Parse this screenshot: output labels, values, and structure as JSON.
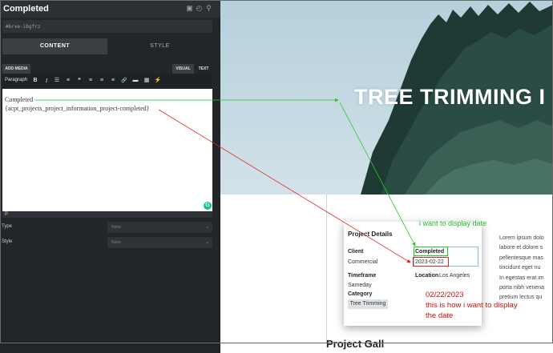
{
  "panel": {
    "title": "Completed",
    "header_icons": [
      "pages-icon",
      "history-icon",
      "search-icon"
    ],
    "element_id": "#brxe-ibgfrz",
    "tabs": [
      {
        "label": "CONTENT",
        "active": true
      },
      {
        "label": "STYLE",
        "active": false
      }
    ],
    "add_media_label": "ADD MEDIA",
    "visual_label": "VISUAL",
    "text_label": "TEXT",
    "format_select": "Paragraph",
    "toolbar_icons": [
      "bold-icon",
      "italic-icon",
      "bullet-list-icon",
      "numbered-list-icon",
      "blockquote-icon",
      "align-left-icon",
      "align-center-icon",
      "align-right-icon",
      "link-icon",
      "horizontal-rule-icon",
      "toolbar-toggle-icon",
      "lightning-icon"
    ],
    "toolbar_glyphs": [
      "B",
      "I",
      "☰",
      "≡",
      "❝",
      "≡",
      "≡",
      "≡",
      "🔗",
      "▬",
      "▦",
      "⚡"
    ],
    "editor_line1": "Completed",
    "editor_line2": "{acpt_projects_project_information_project-completed}",
    "status_path": "P",
    "type_label": "Type",
    "type_value": "None",
    "style_label": "Style",
    "style_value": "None"
  },
  "preview": {
    "hero_title": "TREE TRIMMING I",
    "card": {
      "title": "Project Details",
      "client_label": "Client",
      "client_value": "Commercial",
      "completed_label": "Completed",
      "completed_value": "2023-02-22",
      "timeframe_label": "Timeframe",
      "timeframe_value": "Sameday",
      "location_label": "Location",
      "location_value": "Los Angeles",
      "category_label": "Category",
      "category_tag": "Tree Trimming"
    },
    "lorem_lines": [
      "Lorem ipsum dolo",
      "labore et dolore s",
      "pellentesque mas",
      "tincidunt eget nu",
      "In egestas erat im",
      "porta nibh venena",
      "pretium lectus qu"
    ],
    "gallery_title": "Project Gall"
  },
  "annotations": {
    "green_note": "i want to display date",
    "red_note_line1": "02/22/2023",
    "red_note_line2": "this is how i want to display",
    "red_note_line3": "the date",
    "green_color": "#20c020",
    "red_color": "#cc1111"
  }
}
